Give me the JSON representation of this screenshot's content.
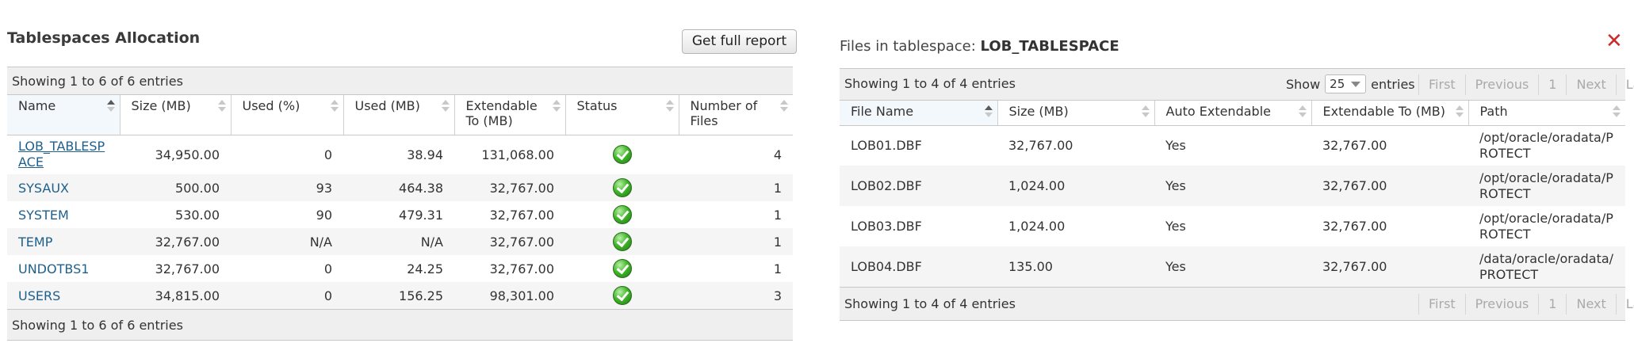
{
  "left": {
    "title": "Tablespaces Allocation",
    "report_button": "Get full report",
    "info_top": "Showing 1 to 6 of 6 entries",
    "info_bottom": "Showing 1 to 6 of 6 entries",
    "columns": [
      "Name",
      "Size (MB)",
      "Used (%)",
      "Used (MB)",
      "Extendable To (MB)",
      "Status",
      "Number of Files"
    ],
    "rows": [
      {
        "name": "LOB_TABLESPACE",
        "size": "34,950.00",
        "used_pct": "0",
        "used_mb": "38.94",
        "ext": "131,068.00",
        "status": "ok",
        "files": "4"
      },
      {
        "name": "SYSAUX",
        "size": "500.00",
        "used_pct": "93",
        "used_mb": "464.38",
        "ext": "32,767.00",
        "status": "ok",
        "files": "1"
      },
      {
        "name": "SYSTEM",
        "size": "530.00",
        "used_pct": "90",
        "used_mb": "479.31",
        "ext": "32,767.00",
        "status": "ok",
        "files": "1"
      },
      {
        "name": "TEMP",
        "size": "32,767.00",
        "used_pct": "N/A",
        "used_mb": "N/A",
        "ext": "32,767.00",
        "status": "ok",
        "files": "1"
      },
      {
        "name": "UNDOTBS1",
        "size": "32,767.00",
        "used_pct": "0",
        "used_mb": "24.25",
        "ext": "32,767.00",
        "status": "ok",
        "files": "1"
      },
      {
        "name": "USERS",
        "size": "34,815.00",
        "used_pct": "0",
        "used_mb": "156.25",
        "ext": "98,301.00",
        "status": "ok",
        "files": "3"
      }
    ]
  },
  "right": {
    "title_prefix": "Files in tablespace:",
    "title_name": "LOB_TABLESPACE",
    "info_top": "Showing 1 to 4 of 4 entries",
    "info_bottom": "Showing 1 to 4 of 4 entries",
    "show_label": "Show",
    "show_value": "25",
    "entries_label": "entries",
    "pager": [
      "First",
      "Previous",
      "1",
      "Next",
      "Last"
    ],
    "columns": [
      "File Name",
      "Size (MB)",
      "Auto Extendable",
      "Extendable To (MB)",
      "Path"
    ],
    "rows": [
      {
        "file": "LOB01.DBF",
        "size": "32,767.00",
        "auto": "Yes",
        "ext": "32,767.00",
        "path": "/opt/oracle/oradata/PROTECT"
      },
      {
        "file": "LOB02.DBF",
        "size": "1,024.00",
        "auto": "Yes",
        "ext": "32,767.00",
        "path": "/opt/oracle/oradata/PROTECT"
      },
      {
        "file": "LOB03.DBF",
        "size": "1,024.00",
        "auto": "Yes",
        "ext": "32,767.00",
        "path": "/opt/oracle/oradata/PROTECT"
      },
      {
        "file": "LOB04.DBF",
        "size": "135.00",
        "auto": "Yes",
        "ext": "32,767.00",
        "path": "/data/oracle/oradata/PROTECT"
      }
    ]
  },
  "colors": {
    "link": "#1f5f8b",
    "close": "#cc2b2b",
    "status_ok": "#42b72a",
    "bar_bg": "#efefef"
  }
}
